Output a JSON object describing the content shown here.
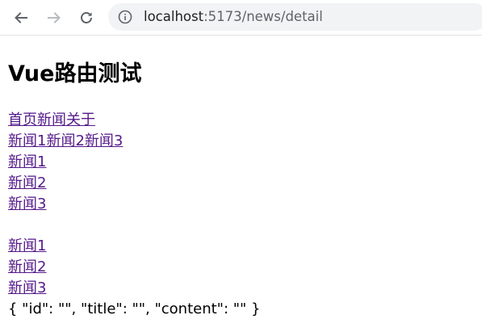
{
  "browser": {
    "url_host": "localhost",
    "url_path": ":5173/news/detail"
  },
  "page": {
    "title": "Vue路由测试",
    "main_nav": [
      "首页",
      "新闻",
      "关于"
    ],
    "news_tabs": [
      "新闻1",
      "新闻2",
      "新闻3"
    ],
    "news_list_1": [
      "新闻1",
      "新闻2",
      "新闻3"
    ],
    "news_list_2": [
      "新闻1",
      "新闻2",
      "新闻3"
    ],
    "detail_text": "{ \"id\": \"\", \"title\": \"\", \"content\": \"\" }"
  }
}
